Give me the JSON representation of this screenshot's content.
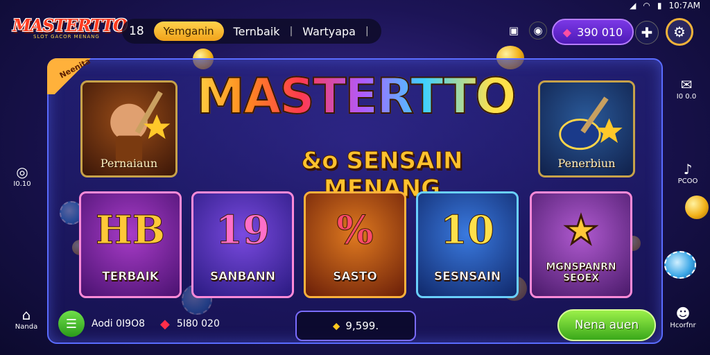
{
  "status_bar": {
    "time": "10:7AM",
    "icons": [
      "wifi-icon",
      "signal-icon",
      "battery-icon"
    ]
  },
  "logo": {
    "text": "MASTERTTO",
    "sub": "SLOT GACOR MENANG"
  },
  "top_nav": {
    "number": "18",
    "active_pill": "Yemganin",
    "link_1": "Ternbaik",
    "separator": "|",
    "link_2": "Wartyapa",
    "trailing": "|"
  },
  "top_right": {
    "balance": "390 010",
    "icons": [
      "calendar-icon",
      "shield-icon",
      "gem-icon",
      "plus-icon",
      "settings-icon"
    ]
  },
  "ribbon": {
    "text": "Neenita"
  },
  "hero": {
    "title": "MASTERTTO",
    "subtitle": "&o SENSAIN MENANG"
  },
  "features": [
    {
      "label": "Pernaiaun"
    },
    {
      "label": "Penerbiun"
    }
  ],
  "game_cards": [
    {
      "big": "HB",
      "label": "TERBAIK",
      "bg": "#6a2390",
      "accent": "#ffc838"
    },
    {
      "big": "19",
      "label": "SANBANN",
      "bg": "#4a2aa8",
      "accent": "#ff5fb8"
    },
    {
      "big": "%",
      "label": "SASTO",
      "bg": "#8a3a10",
      "accent": "#ff3a5a"
    },
    {
      "big": "10",
      "label": "SESNSAIN",
      "bg": "#1a4aa8",
      "accent": "#ffe04a"
    },
    {
      "big": "★",
      "label": "MGNSPANRN SEOEX",
      "bg": "#7a2a9a",
      "accent": "#ffc838"
    }
  ],
  "bottom_bar": {
    "left_label": "Aodi 0I9O8",
    "gem_value": "5I80 020",
    "center_value": "9,599.",
    "cta_label": "Nena auen"
  },
  "side_left": [
    {
      "label": "I0.10",
      "icon": "user-circle-icon"
    },
    {
      "label": "Nanda",
      "icon": "home-icon"
    }
  ],
  "side_right": [
    {
      "label": "I0 0.0",
      "icon": "chat-icon"
    },
    {
      "label": "PCOO",
      "icon": "bell-icon"
    },
    {
      "label": "Hcorfnr",
      "icon": "profile-icon"
    }
  ]
}
